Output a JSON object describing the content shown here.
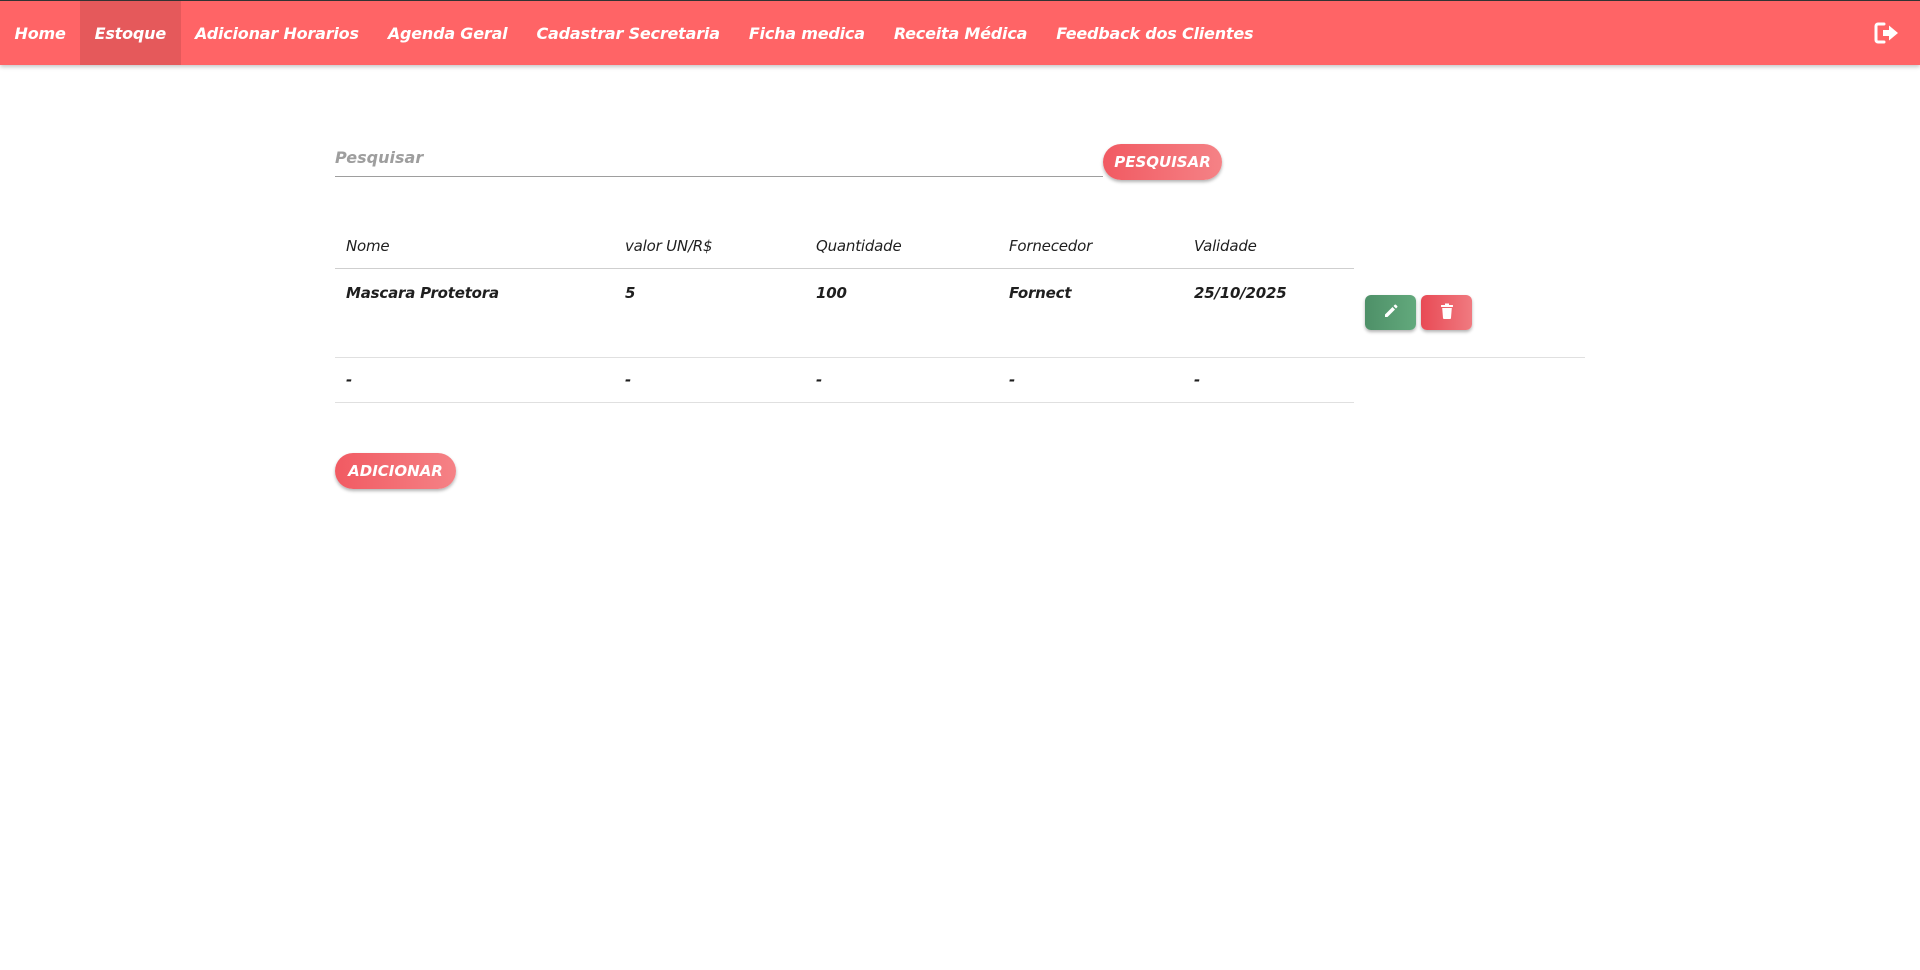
{
  "nav": {
    "items": [
      {
        "label": "Home",
        "active": false
      },
      {
        "label": "Estoque",
        "active": true
      },
      {
        "label": "Adicionar Horarios",
        "active": false
      },
      {
        "label": "Agenda Geral",
        "active": false
      },
      {
        "label": "Cadastrar Secretaria",
        "active": false
      },
      {
        "label": "Ficha medica",
        "active": false
      },
      {
        "label": "Receita Médica",
        "active": false
      },
      {
        "label": "Feedback dos Clientes",
        "active": false
      }
    ],
    "logout_icon": "logout-icon"
  },
  "search": {
    "placeholder": "Pesquisar",
    "value": "",
    "button_label": "Pesquisar"
  },
  "table": {
    "headers": [
      "Nome",
      "valor UN/R$",
      "Quantidade",
      "Fornecedor",
      "Validade"
    ],
    "rows": [
      [
        "Mascara Protetora",
        "5",
        "100",
        "Fornect",
        "25/10/2025"
      ],
      [
        "-",
        "-",
        "-",
        "-",
        "-"
      ]
    ],
    "row_actions": {
      "edit_icon": "pencil-icon",
      "delete_icon": "trash-icon"
    }
  },
  "add_button_label": "Adicionar",
  "colors": {
    "navbar": "#ff6466",
    "accent": "#f15a62",
    "edit": "#4e9068",
    "delete": "#e84a55"
  }
}
